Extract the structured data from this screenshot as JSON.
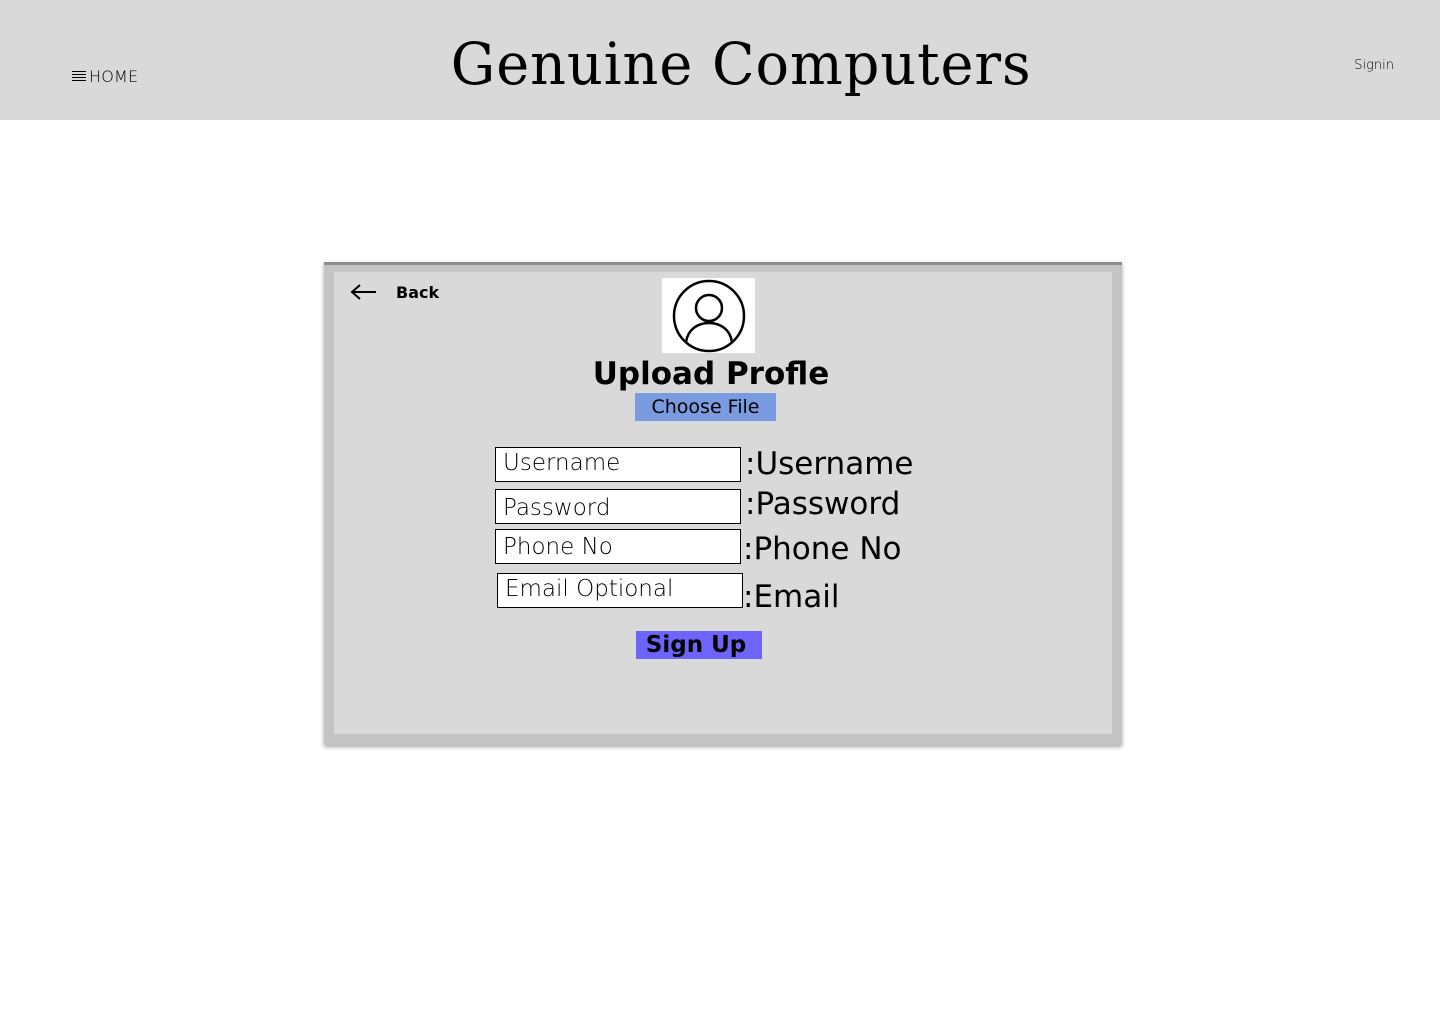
{
  "header": {
    "home_label": "HOME",
    "title": "Genuine Computers",
    "signin_label": "Signin"
  },
  "card": {
    "back_label": "Back",
    "upload_title": "Upload Profle",
    "choose_file_label": "Choose File",
    "fields": {
      "username": {
        "placeholder": "Username",
        "label": ":Username"
      },
      "password": {
        "placeholder": "Password",
        "label": ":Password"
      },
      "phone": {
        "placeholder": "Phone No",
        "label": ":Phone No"
      },
      "email": {
        "placeholder": "Email Optional",
        "label": ":Email"
      }
    },
    "signup_label": "Sign Up"
  },
  "colors": {
    "header_bg": "#d9d9d9",
    "card_bg": "#d9d9d9",
    "choose_file_bg": "#7b9be0",
    "signup_bg": "#6d64fb"
  },
  "icons": [
    "hamburger-icon",
    "back-arrow-icon",
    "user-avatar-icon"
  ]
}
